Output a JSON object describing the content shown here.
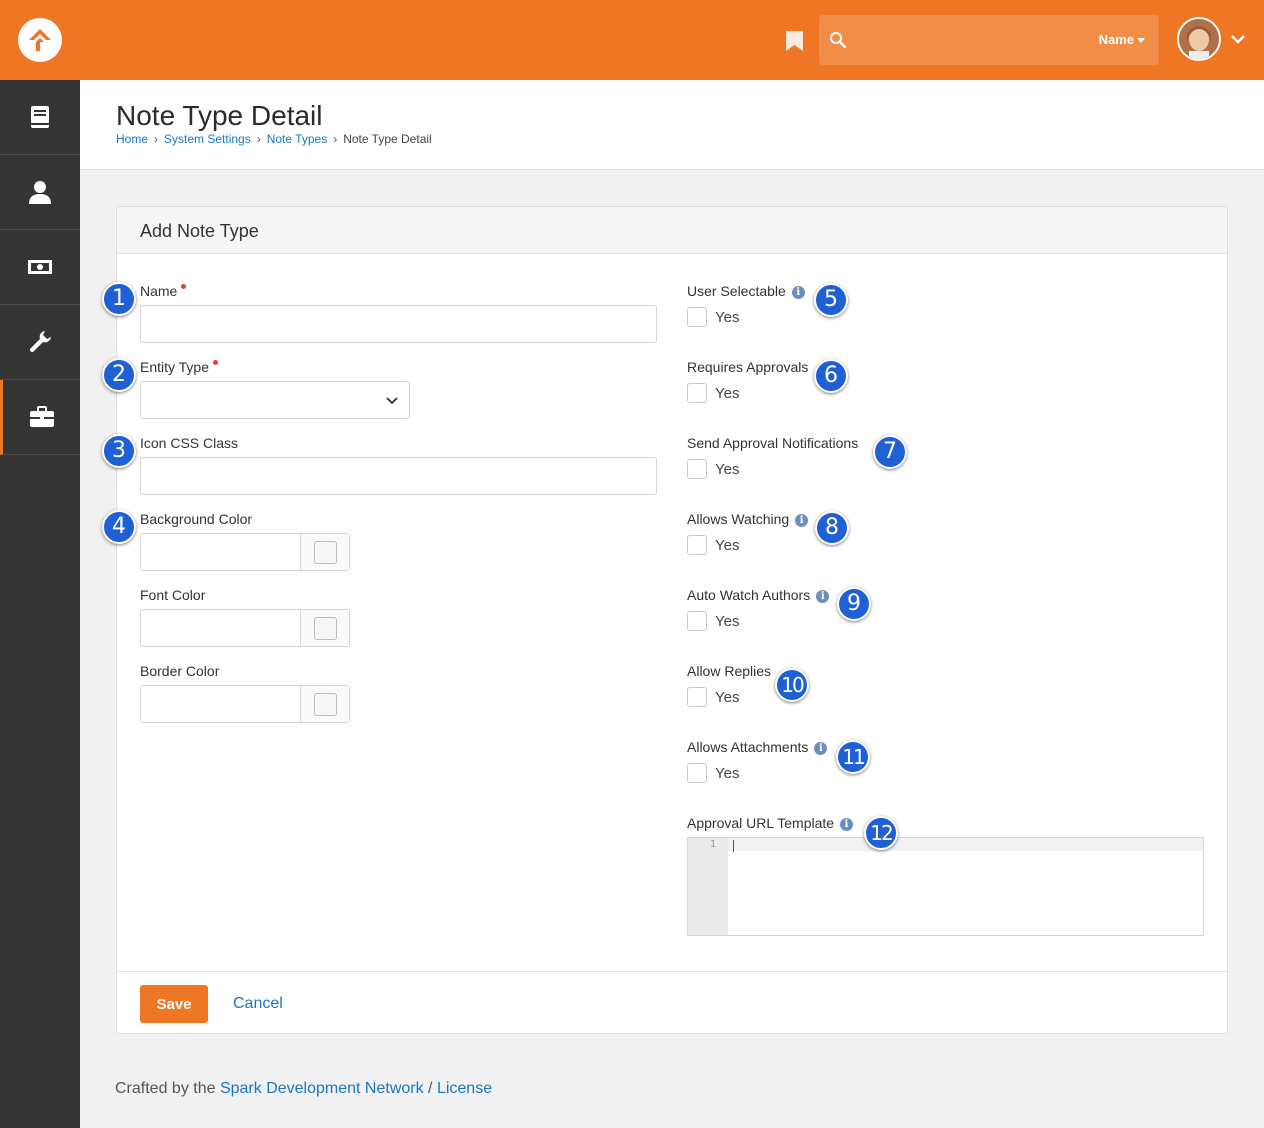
{
  "topbar": {
    "search": {
      "placeholder": "",
      "value": "",
      "filter_label": "Name"
    },
    "colors": {
      "brand": "#ee7625"
    }
  },
  "sidebar": {
    "items": [
      {
        "icon": "book-icon"
      },
      {
        "icon": "person-icon"
      },
      {
        "icon": "money-icon"
      },
      {
        "icon": "wrench-icon"
      },
      {
        "icon": "briefcase-icon",
        "active": true
      }
    ]
  },
  "header": {
    "title": "Note Type Detail",
    "breadcrumb": [
      "Home",
      "System Settings",
      "Note Types",
      "Note Type Detail"
    ]
  },
  "panel": {
    "title": "Add Note Type",
    "left_fields": {
      "name": {
        "label": "Name",
        "required": true,
        "value": ""
      },
      "entity_type": {
        "label": "Entity Type",
        "required": true,
        "value": ""
      },
      "icon_css_class": {
        "label": "Icon CSS Class",
        "value": ""
      },
      "background_color": {
        "label": "Background Color",
        "value": ""
      },
      "font_color": {
        "label": "Font Color",
        "value": ""
      },
      "border_color": {
        "label": "Border Color",
        "value": ""
      }
    },
    "right_fields": [
      {
        "label": "User Selectable",
        "option": "Yes",
        "info": true,
        "checked": false
      },
      {
        "label": "Requires Approvals",
        "option": "Yes",
        "info": false,
        "checked": false
      },
      {
        "label": "Send Approval Notifications",
        "option": "Yes",
        "info": false,
        "checked": false
      },
      {
        "label": "Allows Watching",
        "option": "Yes",
        "info": true,
        "checked": false
      },
      {
        "label": "Auto Watch Authors",
        "option": "Yes",
        "info": true,
        "checked": false
      },
      {
        "label": "Allow Replies",
        "option": "Yes",
        "info": false,
        "checked": false
      },
      {
        "label": "Allows Attachments",
        "option": "Yes",
        "info": true,
        "checked": false
      }
    ],
    "approval_url_template": {
      "label": "Approval URL Template",
      "line_number": "1",
      "value": ""
    },
    "badges": [
      "1",
      "2",
      "3",
      "4",
      "5",
      "6",
      "7",
      "8",
      "9",
      "10",
      "11",
      "12"
    ],
    "buttons": {
      "save": "Save",
      "cancel": "Cancel"
    }
  },
  "footer": {
    "prefix": "Crafted by the",
    "link": "Spark Development Network",
    "separator": "/",
    "license": "License"
  }
}
